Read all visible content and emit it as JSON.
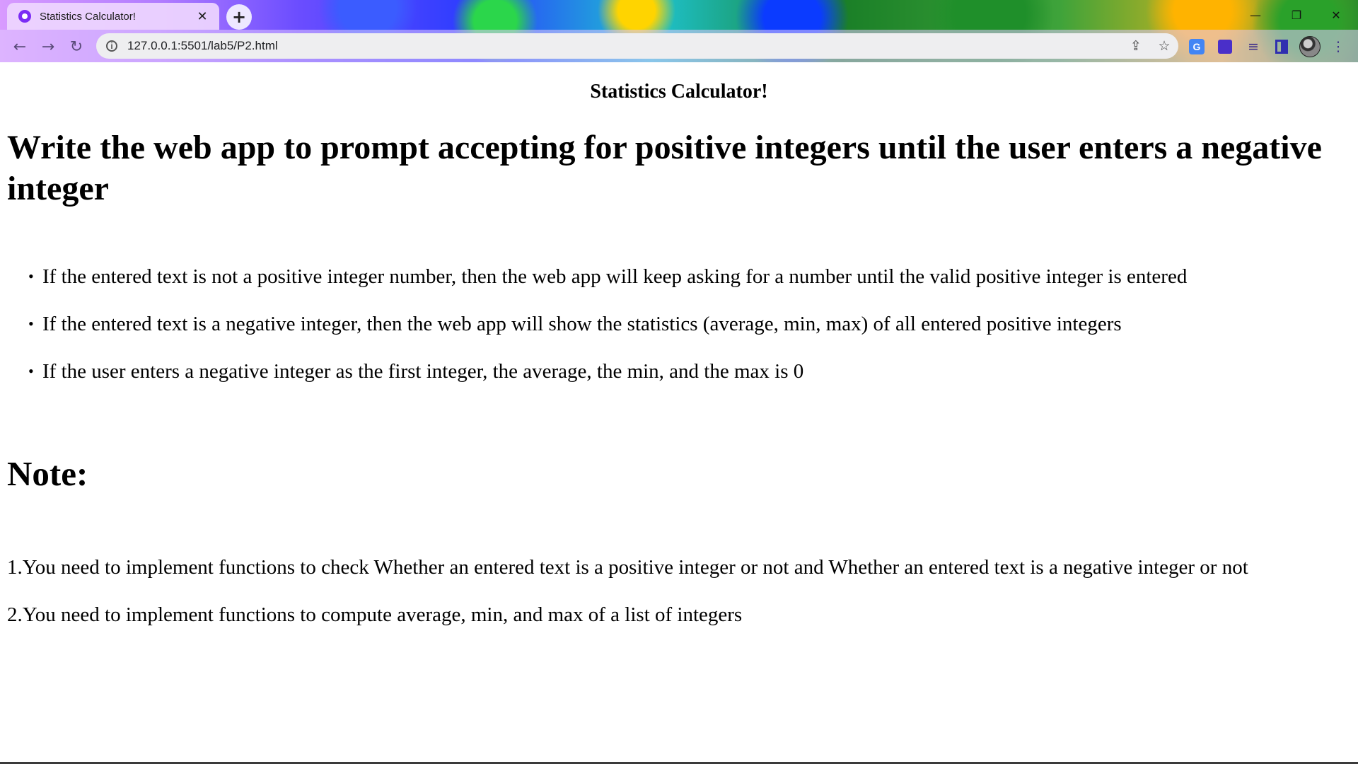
{
  "browser": {
    "tab_title": "Statistics Calculator!",
    "tab_close": "✕",
    "new_tab": "+",
    "url": "127.0.0.1:5501/lab5/P2.html",
    "window_controls": {
      "minimize": "—",
      "maximize": "❐",
      "close": "✕"
    },
    "icons": [
      "back-arrow-icon",
      "forward-arrow-icon",
      "reload-icon",
      "info-icon",
      "share-icon",
      "star-icon",
      "translate-icon",
      "extensions-icon",
      "reading-list-icon",
      "side-panel-icon",
      "profile-avatar",
      "menu-icon"
    ]
  },
  "page": {
    "title": "Statistics Calculator!",
    "heading": "Write the web app to prompt accepting for positive integers until the user enters a negative integer",
    "rules": [
      "If the entered text is not a positive integer number, then the web app will keep asking for a number until the valid positive integer is entered",
      "If the entered text is a negative integer, then the web app will show the statistics (average, min, max) of all entered positive integers",
      "If the user enters a negative integer as the first integer, the average, the min, and the max is 0"
    ],
    "note_heading": "Note:",
    "notes": [
      "1.You need to implement functions to check Whether an entered text is a positive integer or not and Whether an entered text is a negative integer or not",
      "2.You need to implement functions to compute average, min, and max of a list of integers"
    ]
  }
}
